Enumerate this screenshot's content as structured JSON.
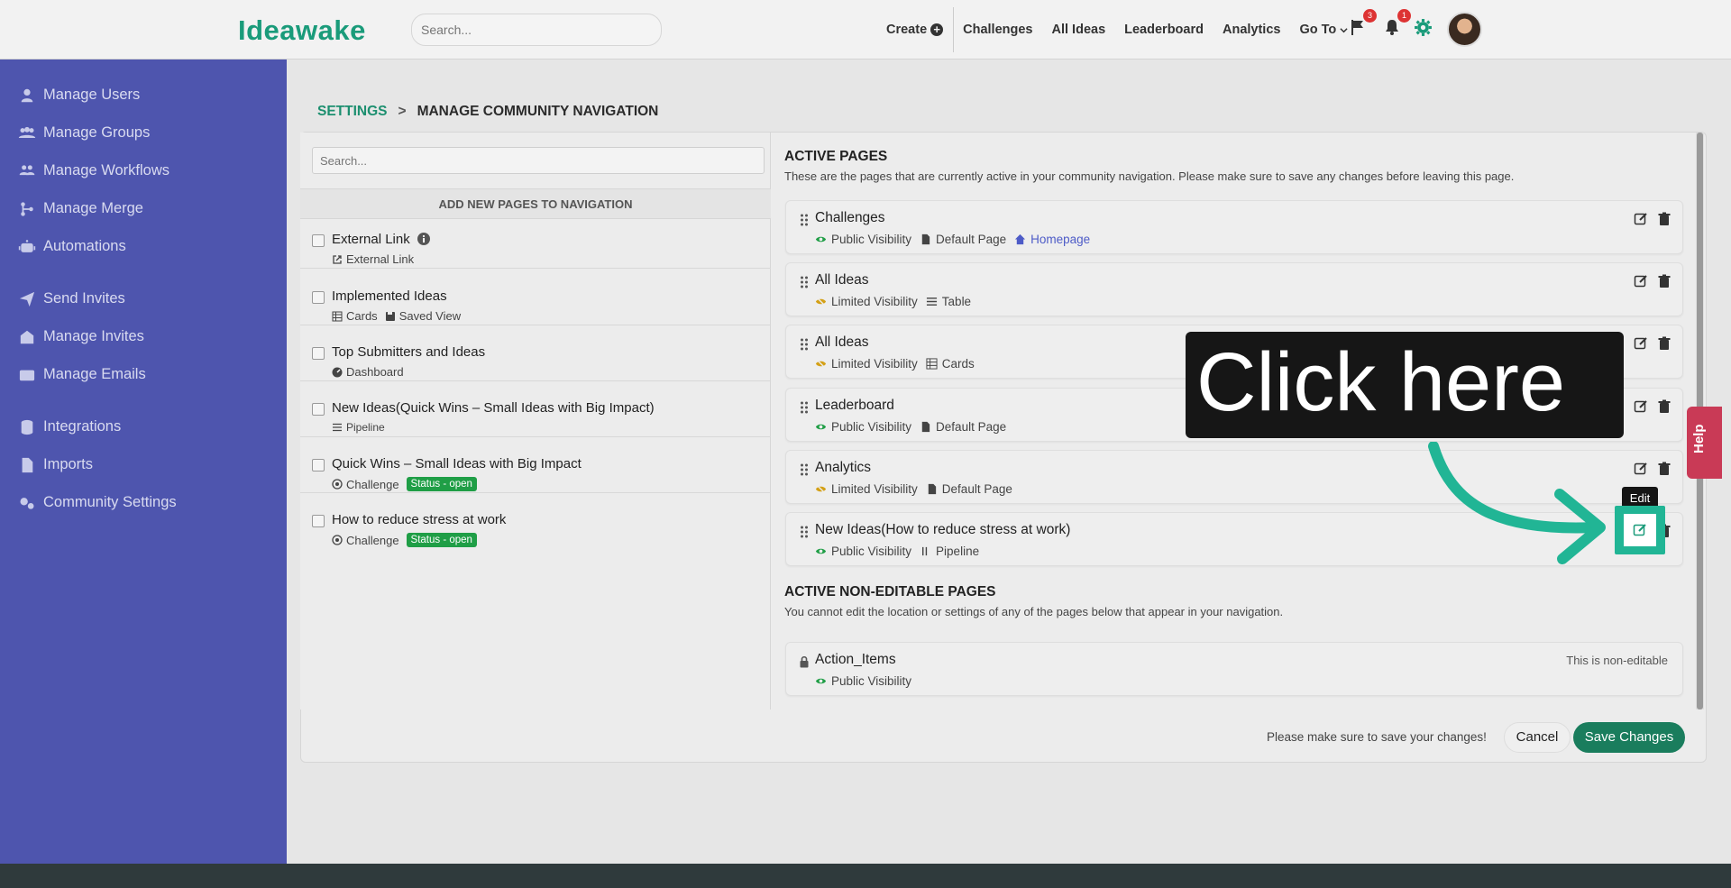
{
  "topbar": {
    "logo_text": "Ideawake",
    "search_placeholder": "Search...",
    "nav": {
      "create": "Create",
      "challenges": "Challenges",
      "all_ideas": "All Ideas",
      "leaderboard": "Leaderboard",
      "analytics": "Analytics",
      "go_to": "Go To"
    },
    "flag_badge": "3",
    "bell_badge": "1",
    "accent_color": "#1a9b7a"
  },
  "sidebar": {
    "bg_color": "#4e55ae",
    "items": [
      {
        "label": "Manage Users",
        "icon": "user-icon"
      },
      {
        "label": "Manage Groups",
        "icon": "users-icon"
      },
      {
        "label": "Manage Workflows",
        "icon": "workflow-icon"
      },
      {
        "label": "Manage Merge",
        "icon": "merge-icon"
      },
      {
        "label": "Automations",
        "icon": "robot-icon"
      },
      {
        "label": "Send Invites",
        "icon": "send-icon"
      },
      {
        "label": "Manage Invites",
        "icon": "invite-icon"
      },
      {
        "label": "Manage Emails",
        "icon": "mail-icon"
      },
      {
        "label": "Integrations",
        "icon": "database-icon"
      },
      {
        "label": "Imports",
        "icon": "file-icon"
      },
      {
        "label": "Community Settings",
        "icon": "gears-icon"
      }
    ]
  },
  "breadcrumb": {
    "parent": "SETTINGS",
    "current": "MANAGE COMMUNITY NAVIGATION"
  },
  "left_panel": {
    "search_placeholder": "Search...",
    "heading": "ADD NEW PAGES TO NAVIGATION",
    "items": [
      {
        "title": "External Link",
        "meta": [
          "External Link"
        ]
      },
      {
        "title": "Implemented Ideas",
        "meta": [
          "Cards",
          "Saved View"
        ]
      },
      {
        "title": "Top Submitters and Ideas",
        "meta": [
          "Dashboard"
        ]
      },
      {
        "title": "New Ideas(Quick Wins – Small Ideas with Big Impact)",
        "meta": [
          "Pipeline"
        ]
      },
      {
        "title": "Quick Wins – Small Ideas with Big Impact",
        "meta": [
          "Challenge"
        ],
        "status": "Status - open"
      },
      {
        "title": "How to reduce stress at work",
        "meta": [
          "Challenge"
        ],
        "status": "Status - open"
      }
    ]
  },
  "active_pages": {
    "title": "ACTIVE PAGES",
    "description": "These are the pages that are currently active in your community navigation. Please make sure to save any changes before leaving this page.",
    "rows": [
      {
        "title": "Challenges",
        "visibility": "Public Visibility",
        "type": "Default Page",
        "extra": "Homepage"
      },
      {
        "title": "All Ideas",
        "visibility": "Limited Visibility",
        "type": "Table"
      },
      {
        "title": "All Ideas",
        "visibility": "Limited Visibility",
        "type": "Cards"
      },
      {
        "title": "Leaderboard",
        "visibility": "Public Visibility",
        "type": "Default Page"
      },
      {
        "title": "Analytics",
        "visibility": "Limited Visibility",
        "type": "Default Page"
      },
      {
        "title": "New Ideas(How to reduce stress at work)",
        "visibility": "Public Visibility",
        "type": "Pipeline"
      }
    ]
  },
  "non_editable": {
    "title": "ACTIVE NON-EDITABLE PAGES",
    "description": "You cannot edit the location or settings of any of the pages below that appear in your navigation.",
    "rows": [
      {
        "title": "Action_Items",
        "visibility": "Public Visibility",
        "note": "This is non-editable"
      }
    ]
  },
  "footer_actions": {
    "note": "Please make sure to save your changes!",
    "cancel": "Cancel",
    "save": "Save Changes"
  },
  "help_label": "Help",
  "overlay": {
    "callout_text": "Click here",
    "tooltip": "Edit",
    "highlight_color": "#21b595"
  }
}
